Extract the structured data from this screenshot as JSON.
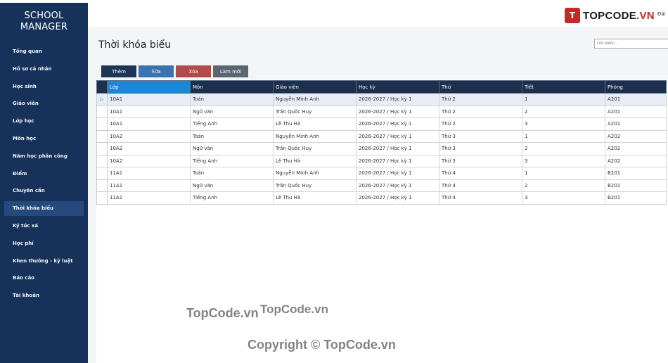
{
  "app": {
    "title_line1": "SCHOOL",
    "title_line2": "MANAGER"
  },
  "sidebar": {
    "items": [
      {
        "label": "Tổng quan"
      },
      {
        "label": "Hồ sơ cá nhân"
      },
      {
        "label": "Học sinh"
      },
      {
        "label": "Giáo viên"
      },
      {
        "label": "Lớp học"
      },
      {
        "label": "Môn học"
      },
      {
        "label": "Năm học  phân công"
      },
      {
        "label": "Điểm"
      },
      {
        "label": "Chuyên cần"
      },
      {
        "label": "Thời khóa biểu",
        "active": true
      },
      {
        "label": "Ký túc xá"
      },
      {
        "label": "Học phí"
      },
      {
        "label": "Khen thưởng - kỷ luật"
      },
      {
        "label": "Báo cáo"
      },
      {
        "label": "Tài khoản"
      }
    ]
  },
  "header": {
    "logo_text_prefix": "TOPCODE",
    "logo_text_suffix": ".VN",
    "logo_mark": "T",
    "link": "Đăi"
  },
  "main": {
    "title": "Thời khóa biểu",
    "search_placeholder": "Tìm kiếm..."
  },
  "toolbar": {
    "add": "Thêm",
    "edit": "Sửa",
    "delete": "Xóa",
    "refresh": "Làm mới"
  },
  "table": {
    "columns": [
      "Lớp",
      "Môn",
      "Giáo viên",
      "Học kỳ",
      "Thứ",
      "Tiết",
      "Phòng"
    ],
    "row_pointer": "▷",
    "rows": [
      [
        "10A1",
        "Toán",
        "Nguyễn Minh Anh",
        "2026-2027 / Học kỳ 1",
        "Thứ 2",
        "1",
        "A201"
      ],
      [
        "10A1",
        "Ngữ văn",
        "Trần Quốc Huy",
        "2026-2027 / Học kỳ 1",
        "Thứ 2",
        "2",
        "A201"
      ],
      [
        "10A1",
        "Tiếng Anh",
        "Lê Thu Hà",
        "2026-2027 / Học kỳ 1",
        "Thứ 2",
        "3",
        "A201"
      ],
      [
        "10A2",
        "Toán",
        "Nguyễn Minh Anh",
        "2026-2027 / Học kỳ 1",
        "Thứ 3",
        "1",
        "A202"
      ],
      [
        "10A2",
        "Ngữ văn",
        "Trần Quốc Huy",
        "2026-2027 / Học kỳ 1",
        "Thứ 3",
        "2",
        "A202"
      ],
      [
        "10A2",
        "Tiếng Anh",
        "Lê Thu Hà",
        "2026-2027 / Học kỳ 1",
        "Thứ 3",
        "3",
        "A202"
      ],
      [
        "11A1",
        "Toán",
        "Nguyễn Minh Anh",
        "2026-2027 / Học kỳ 1",
        "Thứ 4",
        "1",
        "B201"
      ],
      [
        "11A1",
        "Ngữ văn",
        "Trần Quốc Huy",
        "2026-2027 / Học kỳ 1",
        "Thứ 4",
        "2",
        "B201"
      ],
      [
        "11A1",
        "Tiếng Anh",
        "Lê Thu Hà",
        "2026-2027 / Học kỳ 1",
        "Thứ 4",
        "3",
        "B201"
      ]
    ]
  },
  "watermarks": [
    "TopCode.vn",
    "TopCode.vn",
    "Copyright © TopCode.vn"
  ]
}
